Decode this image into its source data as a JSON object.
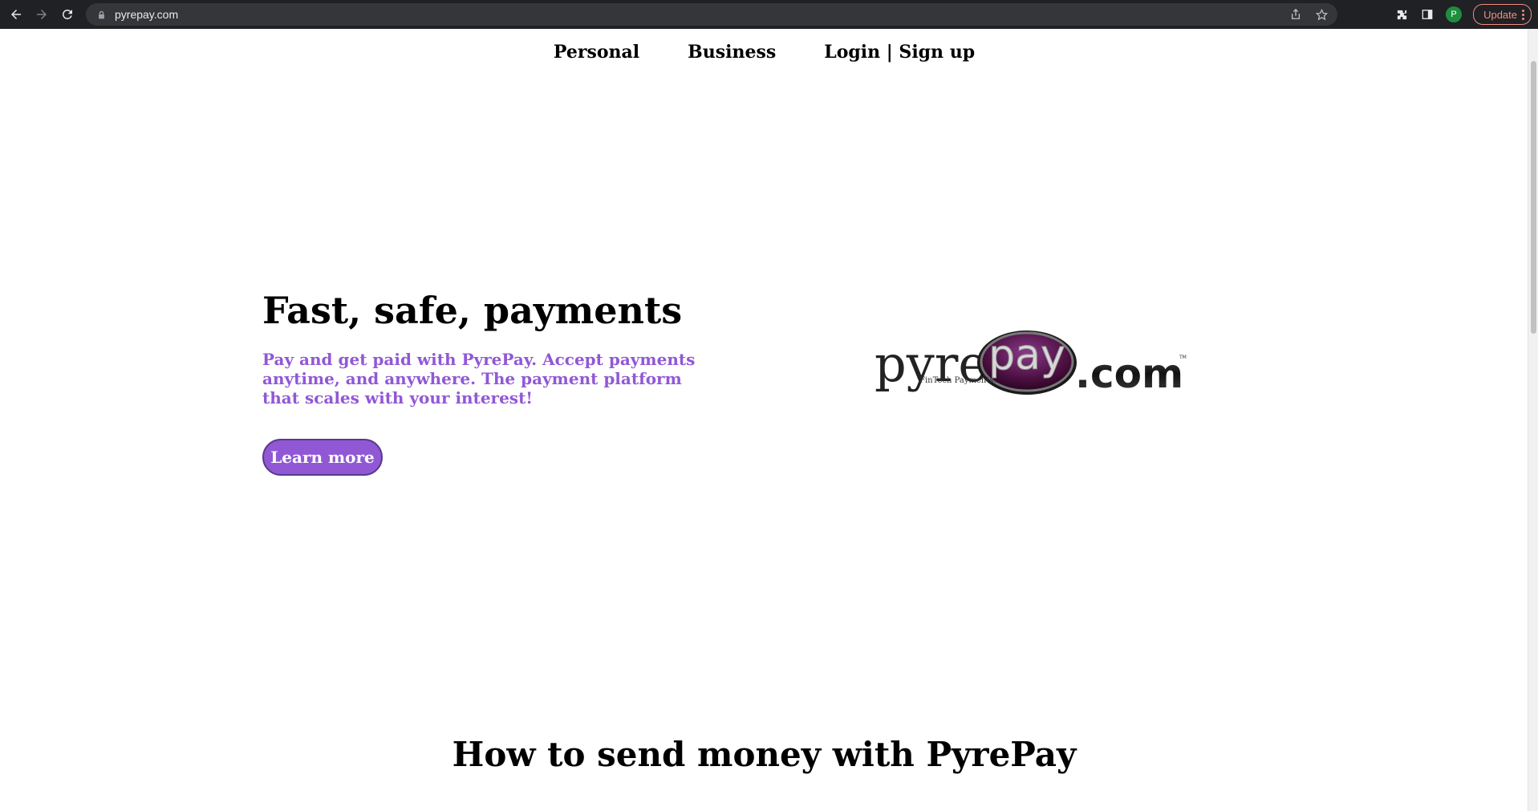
{
  "browser": {
    "url": "pyrepay.com",
    "profile_initial": "P",
    "update_label": "Update",
    "icons": [
      "back-icon",
      "forward-icon",
      "reload-icon",
      "lock-icon",
      "share-icon",
      "star-icon",
      "extensions-icon",
      "side-panel-icon",
      "menu-icon"
    ]
  },
  "nav": {
    "items": [
      "Personal",
      "Business",
      "Login | Sign up"
    ]
  },
  "hero": {
    "title": "Fast, safe, payments",
    "subtitle": "Pay and get paid with PyrePay. Accept payments anytime, and anywhere. The payment platform that scales with your interest!",
    "cta_label": "Learn more",
    "accent_color": "#9158d6"
  },
  "logo": {
    "text_pyre": "pyre",
    "text_pay": "pay",
    "text_com": ".com",
    "tagline": "FinTech Payments.",
    "tm": "TM"
  },
  "section": {
    "title": "How to send money with PyrePay"
  }
}
